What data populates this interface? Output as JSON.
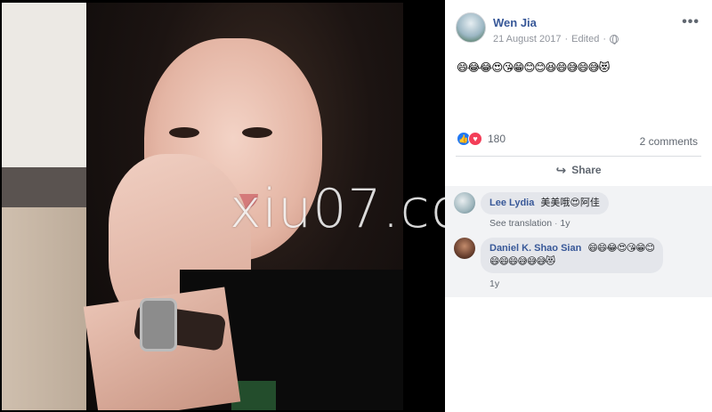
{
  "photo": {
    "watermark": "xiu07.co"
  },
  "post": {
    "author": "Wen Jia",
    "date": "21 August 2017",
    "separator": "·",
    "edited": "Edited",
    "separator2": "·",
    "more": "•••",
    "text": "😄😂😂😍😘😁😊😊😆😄😅😄😅😻",
    "reactions_count": "180",
    "comments_count": "2 comments",
    "share_label": "Share",
    "share_icon": "↪"
  },
  "comments": [
    {
      "name": "Lee Lydia",
      "text": "美美哦😍阿佳",
      "see_translation": "See translation",
      "dot": "·",
      "time": "1y"
    },
    {
      "name": "Daniel K. Shao Sian",
      "text_line1": "😄😄😂😍😘😁😊",
      "text_line2": "😄😄😄😅😅😅😻",
      "time": "1y"
    }
  ],
  "colors": {
    "link": "#385898",
    "muted": "#90949c",
    "like": "#2078f4",
    "love": "#f33e58",
    "comment_bg": "#f2f3f5"
  },
  "icons": {
    "like": "like-icon",
    "love": "love-icon",
    "globe": "globe-icon",
    "share": "share-icon",
    "more": "more-icon"
  }
}
